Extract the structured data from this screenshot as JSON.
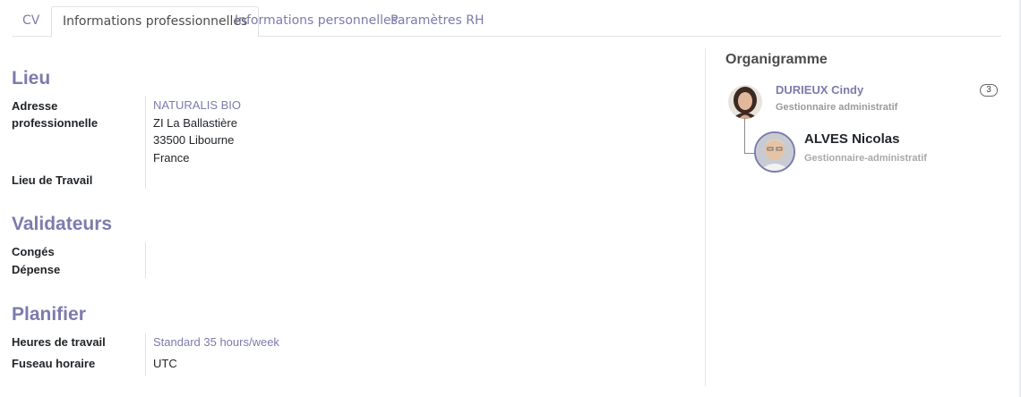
{
  "tabs": [
    {
      "label": "CV"
    },
    {
      "label": "Informations professionnelles"
    },
    {
      "label": "Informations personnelles"
    },
    {
      "label": "Paramètres RH"
    }
  ],
  "lieu": {
    "title": "Lieu",
    "address_label_1": "Adresse",
    "address_label_2": "professionnelle",
    "company": "NATURALIS BIO",
    "street": "ZI La Ballastière",
    "city": "33500 Libourne",
    "country": "France",
    "work_location_label": "Lieu de Travail",
    "work_location_value": ""
  },
  "validateurs": {
    "title": "Validateurs",
    "leave_label": "Congés",
    "expense_label": "Dépense"
  },
  "planifier": {
    "title": "Planifier",
    "hours_label": "Heures de travail",
    "hours_value": "Standard 35 hours/week",
    "tz_label": "Fuseau horaire",
    "tz_value": "UTC"
  },
  "org_chart": {
    "title": "Organigramme",
    "manager": {
      "name": "DURIEUX Cindy",
      "job": "Gestionnaire administratif",
      "subordinates_count": "3"
    },
    "employee": {
      "name": "ALVES Nicolas",
      "job": "Gestionnaire-administratif"
    }
  },
  "colors": {
    "accent": "#7c7bad",
    "text": "#212529",
    "muted": "#9a9a9a"
  }
}
